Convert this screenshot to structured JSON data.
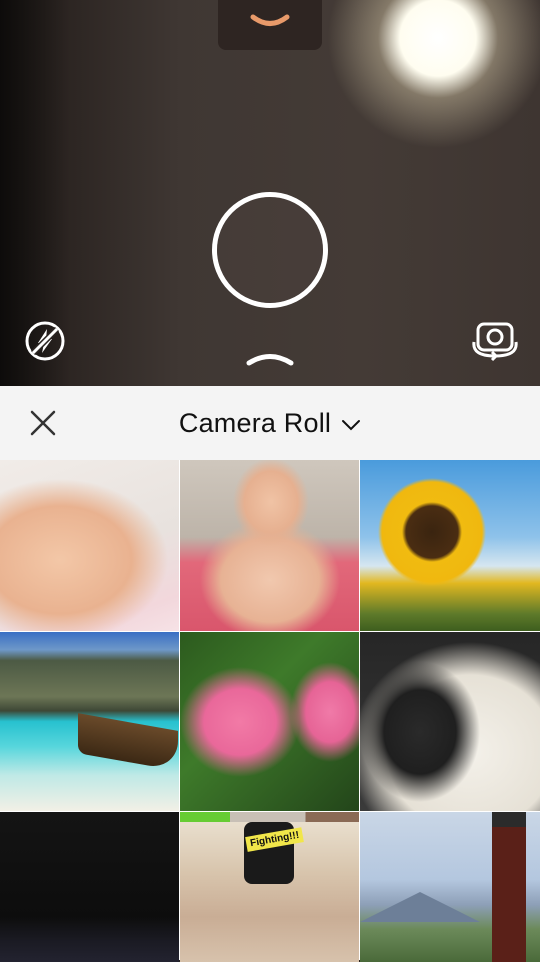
{
  "camera": {
    "pull_tab_icon": "chevron-down-icon",
    "shutter": "shutter-button",
    "flash_icon": "flash-off-icon",
    "expand_icon": "chevron-up-icon",
    "switch_icon": "switch-camera-icon",
    "accent_color": "#e89a6a"
  },
  "header": {
    "close_icon": "close-icon",
    "album_title": "Camera Roll",
    "album_chevron": "chevron-down-icon"
  },
  "grid": {
    "items": [
      {
        "name": "sleeping-baby"
      },
      {
        "name": "baby-in-tub"
      },
      {
        "name": "sunflower"
      },
      {
        "name": "beach-boat"
      },
      {
        "name": "pink-hibiscus"
      },
      {
        "name": "snoopy-plush"
      },
      {
        "name": "night-city"
      },
      {
        "name": "screenshot-sticker",
        "sticker_text": "Fighting!!!"
      },
      {
        "name": "pagoda-mount-fuji"
      }
    ]
  }
}
